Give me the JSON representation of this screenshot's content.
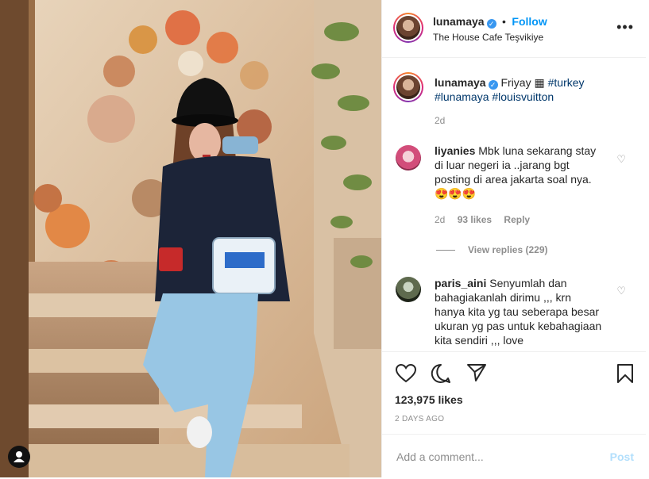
{
  "post": {
    "username": "lunamaya",
    "follow_label": "Follow",
    "location": "The House Cafe Teşvikiye",
    "more_label": "•••"
  },
  "caption": {
    "username": "lunamaya",
    "text": "Friyay",
    "emoji": "▦",
    "hashtags_line1": "#turkey",
    "hashtags_line2": "#lunamaya #louisvuitton",
    "time": "2d"
  },
  "comments": [
    {
      "username": "liyanies",
      "text": "Mbk luna sekarang stay di luar negeri ia ..jarang bgt posting di area jakarta soal nya.",
      "emojis": "😍😍😍",
      "time": "2d",
      "likes": "93 likes",
      "reply": "Reply",
      "view_replies": "View replies (229)"
    },
    {
      "username": "paris_aini",
      "text": "Senyumlah dan bahagiakanlah dirimu ,,, krn hanya kita yg tau seberapa besar ukuran yg pas untuk kebahagiaan kita sendiri ,,, love"
    }
  ],
  "likes": "123,975 likes",
  "time_ago": "2 DAYS AGO",
  "add_comment_placeholder": "Add a comment...",
  "post_button": "Post",
  "colors": {
    "link": "#0095f6",
    "hashtag": "#00376b",
    "muted": "#8e8e8e",
    "post_disabled": "#b2dffc"
  }
}
